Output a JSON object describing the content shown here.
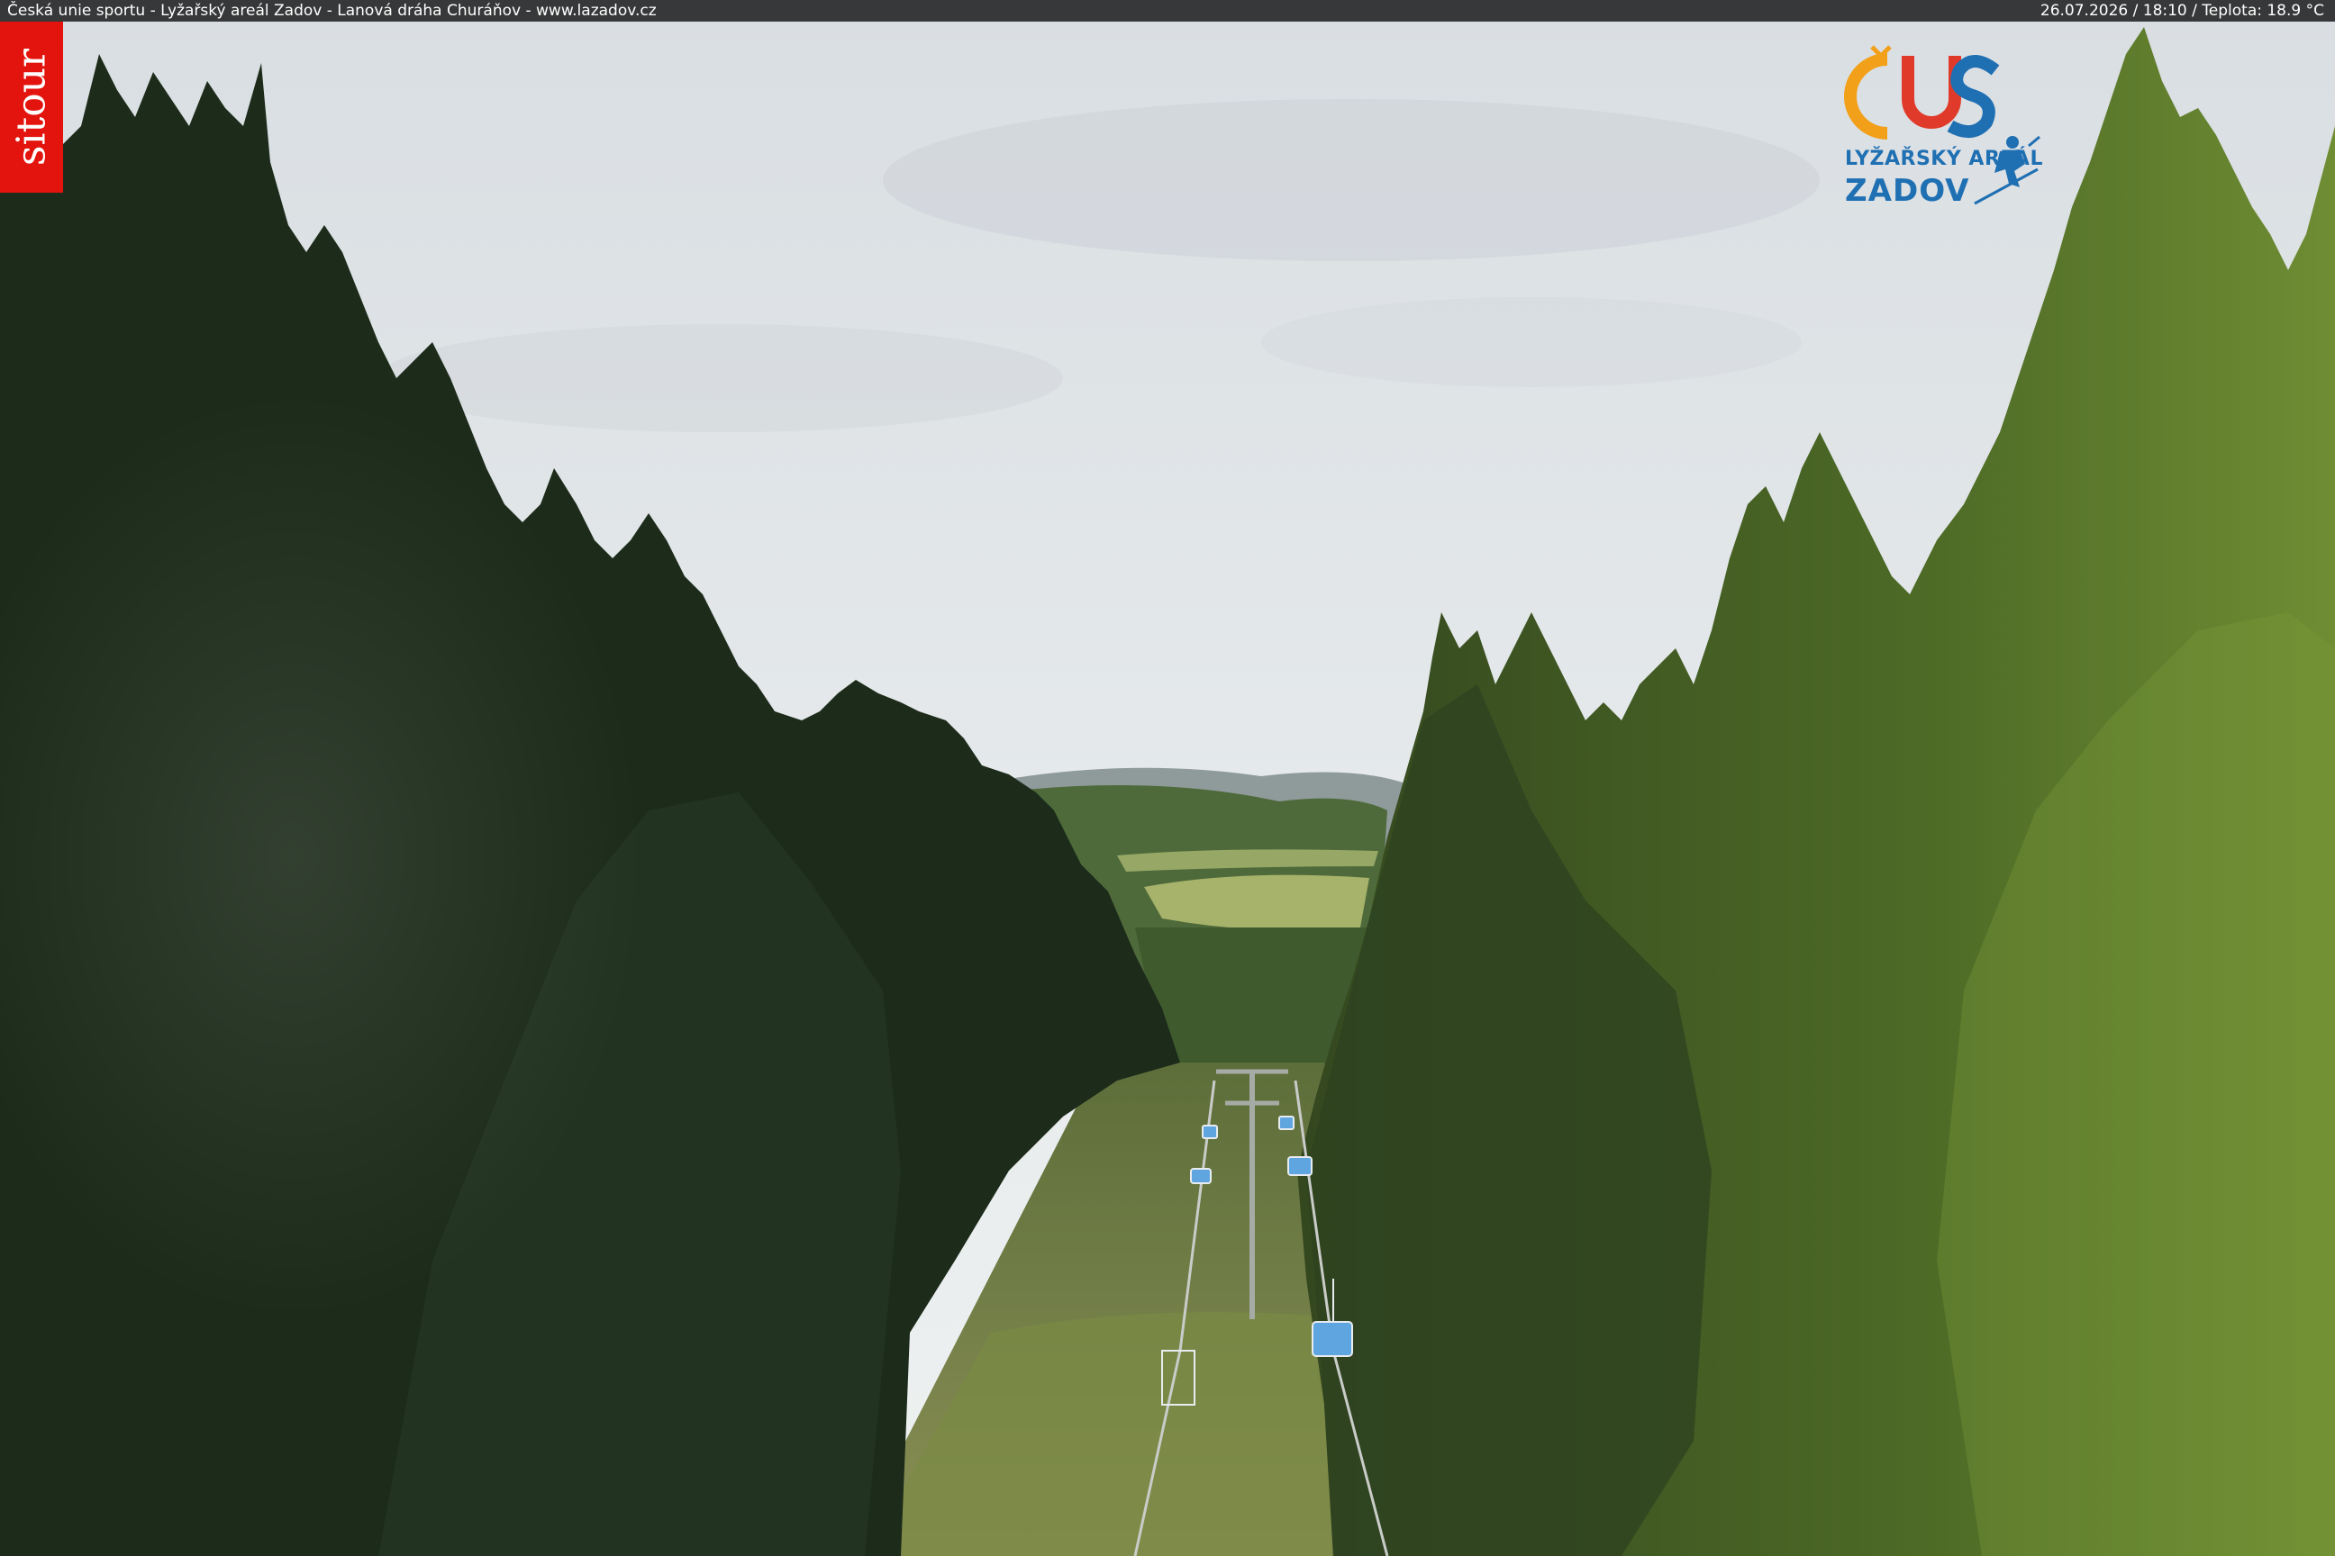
{
  "overlay": {
    "caption": "Česká unie sportu - Lyžařský areál Zadov - Lanová dráha Churáňov - www.lazadov.cz",
    "status": "26.07.2026 / 18:10 / Teplota: 18.9 °C"
  },
  "watermark": {
    "text": "sitour",
    "color": "#e3140e"
  },
  "logo": {
    "line1": "LYŽAŘSKÝ AREÁL",
    "line2": "ZADOV",
    "colors": {
      "blue": "#1f6fb3",
      "orange": "#f2a01a",
      "red": "#e03b2a"
    }
  },
  "scene": {
    "sky_color": "#e4e8ea",
    "forest_dark": "#1e2e1c",
    "forest_lit": "#5c7a2c",
    "meadow": "#7f8f4a",
    "chair_color": "#5fa6e0"
  }
}
